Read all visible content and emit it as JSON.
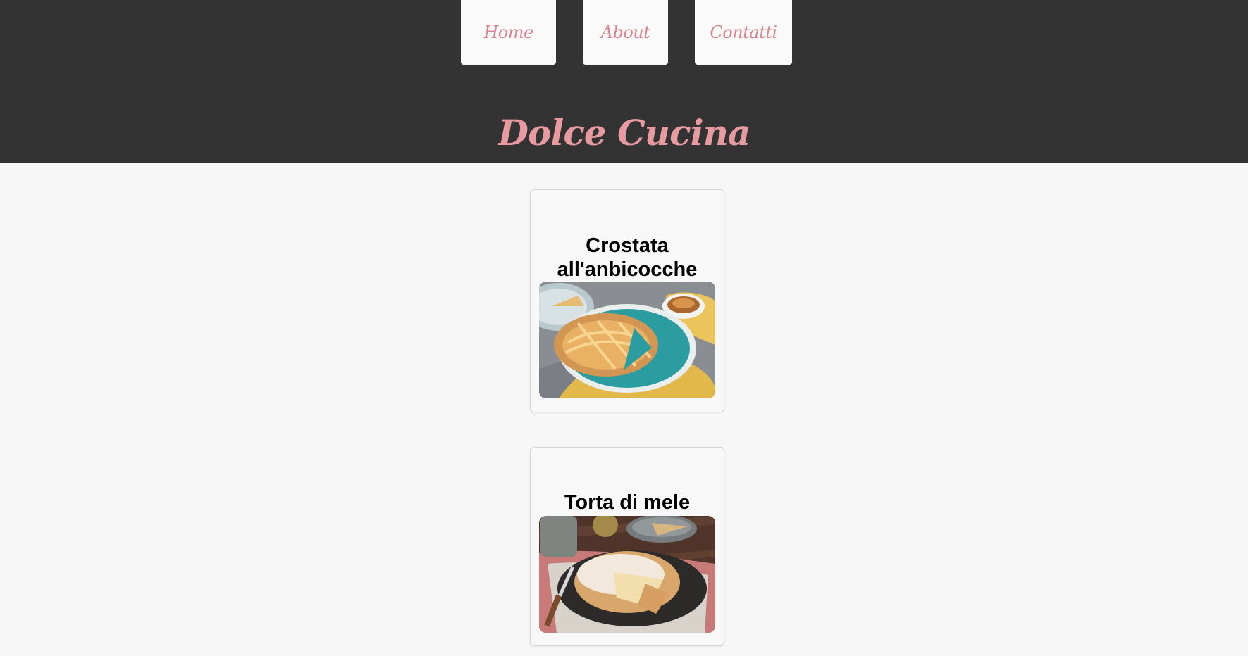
{
  "nav": {
    "items": [
      {
        "label": "Home"
      },
      {
        "label": "About"
      },
      {
        "label": "Contatti"
      }
    ]
  },
  "header": {
    "title": "Dolce Cucina"
  },
  "recipes": [
    {
      "title": "Crostata all'anbicocche",
      "image": "apricot-lattice-tart-photo"
    },
    {
      "title": "Torta di mele",
      "image": "apple-cake-photo"
    }
  ],
  "colors": {
    "header_bg": "#333333",
    "accent_pink": "#e79a9f",
    "page_bg": "#f7f7f7"
  }
}
